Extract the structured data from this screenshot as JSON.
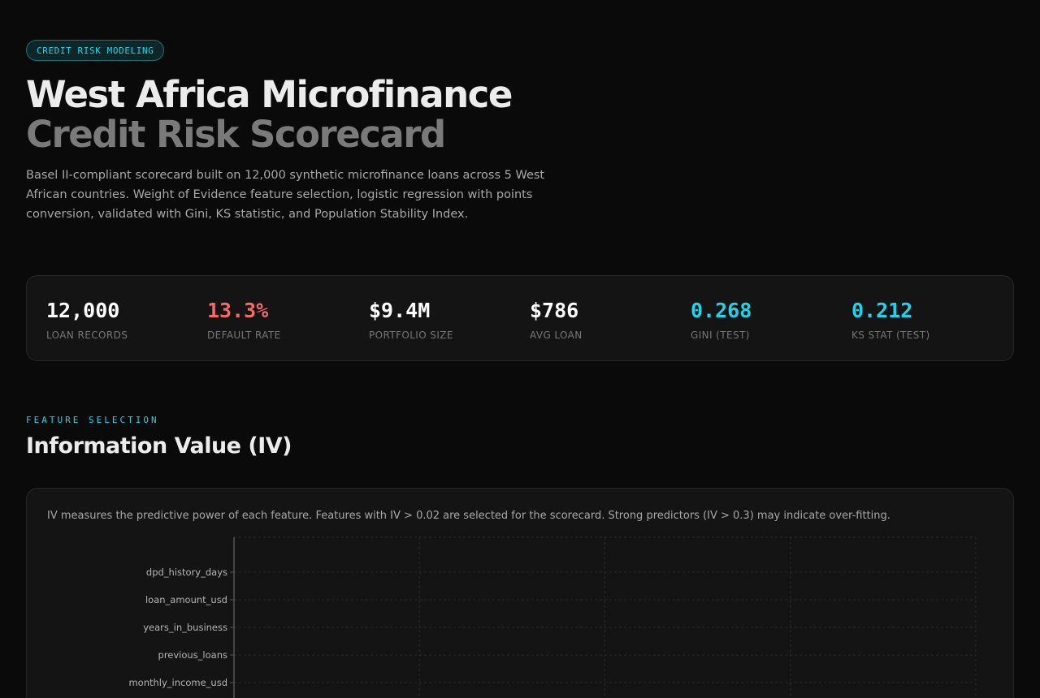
{
  "header": {
    "badge": "CREDIT RISK MODELING",
    "title_line1": "West Africa Microfinance",
    "title_line2": "Credit Risk Scorecard",
    "description": "Basel II-compliant scorecard built on 12,000 synthetic microfinance loans across 5 West African countries. Weight of Evidence feature selection, logistic regression with points conversion, validated with Gini, KS statistic, and Population Stability Index."
  },
  "stats": [
    {
      "value": "12,000",
      "label": "LOAN RECORDS",
      "color": "#ffffff"
    },
    {
      "value": "13.3%",
      "label": "DEFAULT RATE",
      "color": "#f26b6b"
    },
    {
      "value": "$9.4M",
      "label": "PORTFOLIO SIZE",
      "color": "#ffffff"
    },
    {
      "value": "$786",
      "label": "AVG LOAN",
      "color": "#ffffff"
    },
    {
      "value": "0.268",
      "label": "GINI (TEST)",
      "color": "#22d3e6"
    },
    {
      "value": "0.212",
      "label": "KS STAT (TEST)",
      "color": "#22d3e6"
    }
  ],
  "section": {
    "kicker": "FEATURE SELECTION",
    "title": "Information Value (IV)",
    "note": "IV measures the predictive power of each feature. Features with IV > 0.02 are selected for the scorecard. Strong predictors (IV > 0.3) may indicate over-fitting."
  },
  "chart_data": {
    "type": "bar",
    "orientation": "horizontal",
    "categories": [
      "dpd_history_days",
      "loan_amount_usd",
      "years_in_business",
      "previous_loans",
      "monthly_income_usd"
    ],
    "values": [
      null,
      null,
      null,
      null,
      null
    ],
    "title": "",
    "xlabel": "",
    "ylabel": "",
    "grid": true,
    "colors": {
      "axis": "#555555",
      "grid": "#2a2a2a",
      "bar": "#22d3e6"
    }
  }
}
